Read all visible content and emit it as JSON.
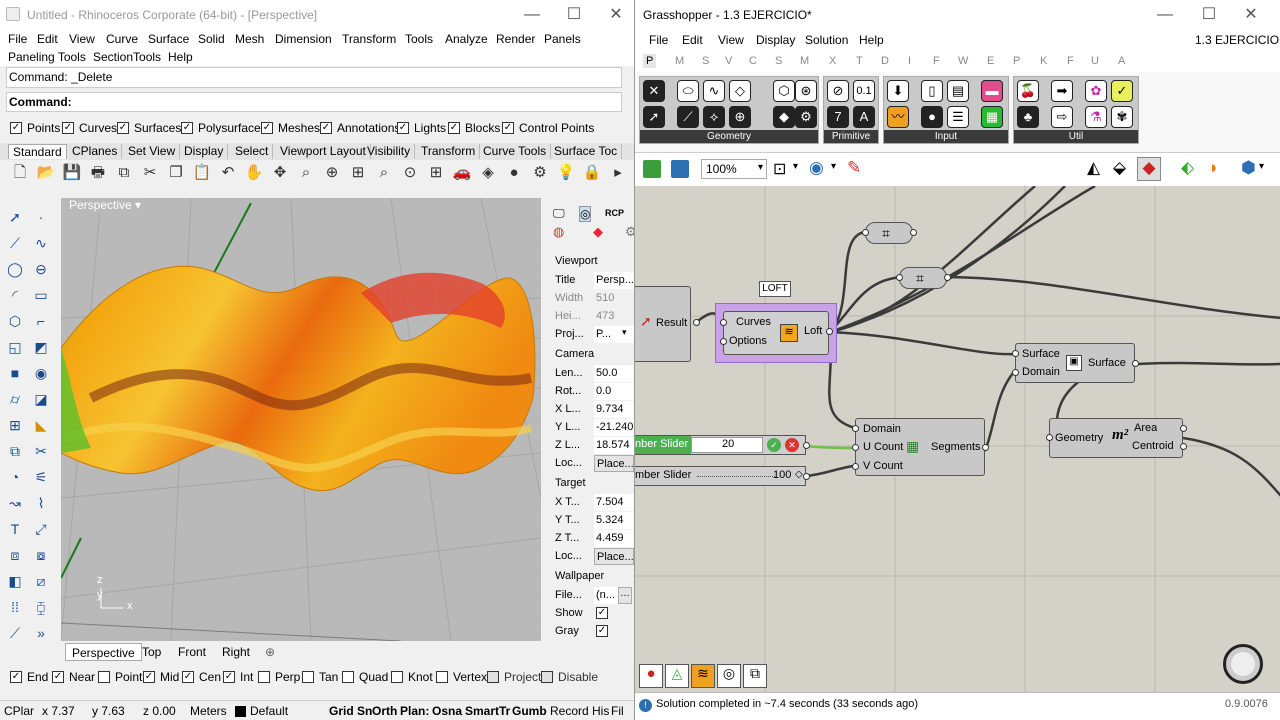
{
  "rhino": {
    "title": "Untitled - Rhinoceros Corporate (64-bit) - [Perspective]",
    "menu_row1": [
      "File",
      "Edit",
      "View",
      "Curve",
      "Surface",
      "Solid",
      "Mesh",
      "Dimension",
      "Transform",
      "Tools",
      "Analyze",
      "Render",
      "Panels"
    ],
    "menu_row2": [
      "Paneling Tools",
      "SectionTools",
      "Help"
    ],
    "command_history": "Command: _Delete",
    "command_prompt": "Command:",
    "filter_checks": [
      {
        "label": "Points",
        "checked": true
      },
      {
        "label": "Curves",
        "checked": true
      },
      {
        "label": "Surfaces",
        "checked": true
      },
      {
        "label": "Polysurfaces",
        "checked": true
      },
      {
        "label": "Meshes",
        "checked": true
      },
      {
        "label": "Annotations",
        "checked": true
      },
      {
        "label": "Lights",
        "checked": true
      },
      {
        "label": "Blocks",
        "checked": true
      },
      {
        "label": "Control Points",
        "checked": true
      }
    ],
    "toolbar_tabs": [
      "Standard",
      "CPlanes",
      "Set View",
      "Display",
      "Select",
      "Viewport Layout",
      "Visibility",
      "Transform",
      "Curve Tools",
      "Surface Toc"
    ],
    "viewport_label": "Perspective",
    "viewport_tabs": [
      "Perspective",
      "Top",
      "Front",
      "Right"
    ],
    "properties": {
      "viewport_section": "Viewport",
      "title_k": "Title",
      "title_v": "Persp...",
      "width_k": "Width",
      "width_v": "510",
      "height_k": "Hei...",
      "height_v": "473",
      "proj_k": "Proj...",
      "proj_v": "P...",
      "camera_section": "Camera",
      "len_k": "Len...",
      "len_v": "50.0",
      "rot_k": "Rot...",
      "rot_v": "0.0",
      "xl_k": "X L...",
      "xl_v": "9.734",
      "yl_k": "Y L...",
      "yl_v": "-21.240",
      "zl_k": "Z L...",
      "zl_v": "18.574",
      "loc_k": "Loc...",
      "loc_v": "Place...",
      "target_section": "Target",
      "xt_k": "X T...",
      "xt_v": "7.504",
      "yt_k": "Y T...",
      "yt_v": "5.324",
      "zt_k": "Z T...",
      "zt_v": "4.459",
      "loc2_k": "Loc...",
      "loc2_v": "Place...",
      "wallpaper_section": "Wallpaper",
      "file_k": "File...",
      "file_v": "(n...",
      "show_k": "Show",
      "gray_k": "Gray"
    },
    "osnaps": [
      {
        "label": "End",
        "checked": true
      },
      {
        "label": "Near",
        "checked": true
      },
      {
        "label": "Point",
        "checked": false
      },
      {
        "label": "Mid",
        "checked": true
      },
      {
        "label": "Cen",
        "checked": true
      },
      {
        "label": "Int",
        "checked": true
      },
      {
        "label": "Perp",
        "checked": false
      },
      {
        "label": "Tan",
        "checked": false
      },
      {
        "label": "Quad",
        "checked": false
      },
      {
        "label": "Knot",
        "checked": false
      },
      {
        "label": "Vertex",
        "checked": false
      },
      {
        "label": "Project",
        "checked": false
      },
      {
        "label": "Disable",
        "checked": false
      }
    ],
    "status": {
      "cplane": "CPlar",
      "x": "x 7.37",
      "y": "y 7.63",
      "z": "z 0.00",
      "units": "Meters",
      "layer": "Default",
      "toggles": [
        "Grid Sn",
        "Orth",
        "Plan:",
        "Osna",
        "SmartTr",
        "Gumb",
        "Record His",
        "Fil"
      ]
    }
  },
  "gh": {
    "title": "Grasshopper - 1.3 EJERCICIO*",
    "doc_name": "1.3 EJERCICIO",
    "menu": [
      "File",
      "Edit",
      "View",
      "Display",
      "Solution",
      "Help"
    ],
    "category_tabs": [
      "P",
      "M",
      "S",
      "V",
      "C",
      "S",
      "M",
      "X",
      "T",
      "D",
      "I",
      "F",
      "W",
      "E",
      "P",
      "K",
      "F",
      "U",
      "A"
    ],
    "ribbon_groups": [
      "Geometry",
      "Primitive",
      "Input",
      "Util"
    ],
    "zoom": "100%",
    "nodes": {
      "result_label": "Result",
      "loft_tooltip": "LOFT",
      "loft_in1": "Curves",
      "loft_in2": "Options",
      "loft_out": "Loft",
      "surface_in1": "Surface",
      "surface_in2": "Domain",
      "surface_out": "Surface",
      "seg_in1": "Domain",
      "seg_in2": "U Count",
      "seg_in3": "V Count",
      "seg_out": "Segments",
      "area_in": "Geometry",
      "area_out1": "Area",
      "area_out2": "Centroid",
      "area_symbol": "m²",
      "slider1_label": "nber Slider",
      "slider1_value": "20",
      "slider2_label": "mber Slider",
      "slider2_value": "100"
    },
    "status_text": "Solution completed in ~7.4 seconds (33 seconds ago)",
    "version": "0.9.0076"
  },
  "colors": {
    "gh_canvas": "#d4d1c9",
    "rhino_viewport": "#b9b9b9",
    "selected_node": "#c9a3e8",
    "slider_green": "#4caf50"
  }
}
